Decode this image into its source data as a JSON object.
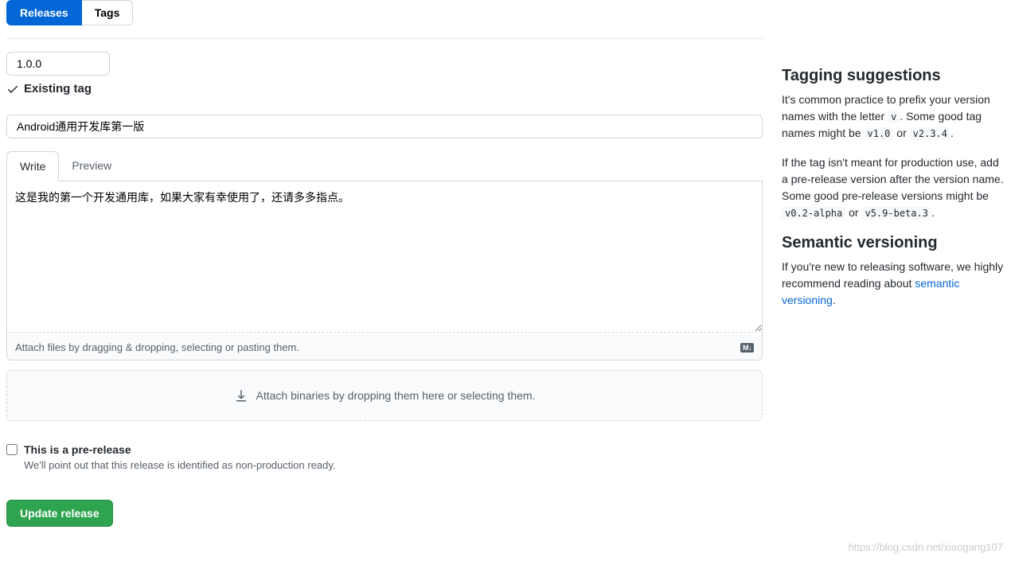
{
  "tabs": {
    "releases": "Releases",
    "tags": "Tags"
  },
  "tag_value": "1.0.0",
  "existing_tag_label": "Existing tag",
  "release_title": "Android通用开发库第一版",
  "editor_tabs": {
    "write": "Write",
    "preview": "Preview"
  },
  "description": "这是我的第一个开发通用库，如果大家有幸使用了，还请多多指点。",
  "attach_hint": "Attach files by dragging & dropping, selecting or pasting them.",
  "drop_zone_text": "Attach binaries by dropping them here or selecting them.",
  "prerelease": {
    "label": "This is a pre-release",
    "desc": "We'll point out that this release is identified as non-production ready."
  },
  "update_button": "Update release",
  "sidebar": {
    "tagging_title": "Tagging suggestions",
    "tagging_p1_a": "It's common practice to prefix your version names with the letter ",
    "tagging_p1_code1": "v",
    "tagging_p1_b": ". Some good tag names might be ",
    "tagging_p1_code2": "v1.0",
    "tagging_p1_c": " or ",
    "tagging_p1_code3": "v2.3.4",
    "tagging_p1_d": ".",
    "tagging_p2_a": "If the tag isn't meant for production use, add a pre-release version after the version name. Some good pre-release versions might be ",
    "tagging_p2_code1": "v0.2-alpha",
    "tagging_p2_b": " or ",
    "tagging_p2_code2": "v5.9-beta.3",
    "tagging_p2_c": ".",
    "semver_title": "Semantic versioning",
    "semver_p_a": "If you're new to releasing software, we highly recommend reading about ",
    "semver_link": "semantic versioning",
    "semver_p_b": "."
  },
  "watermark": "https://blog.csdn.net/xiaogang107"
}
